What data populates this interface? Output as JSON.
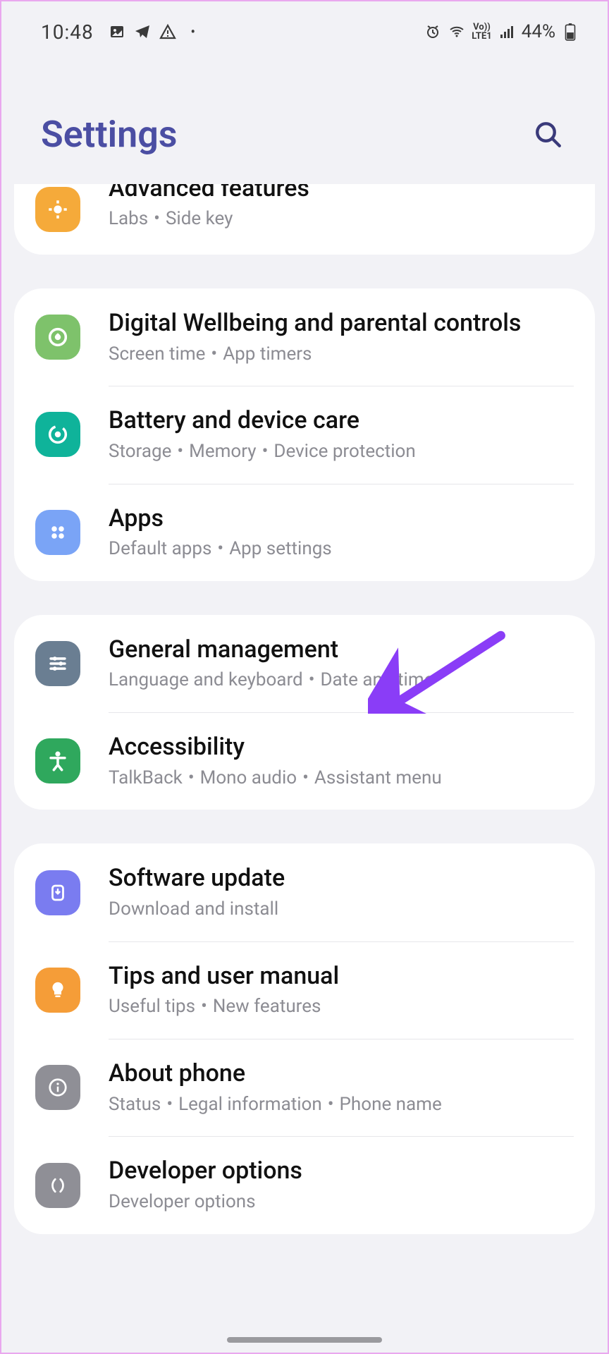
{
  "status": {
    "time": "10:48",
    "battery": "44%",
    "net_label": "LTE1",
    "vo_label": "Vo))"
  },
  "header": {
    "title": "Settings"
  },
  "groups": [
    {
      "items": [
        {
          "id": "advanced",
          "title": "Advanced features",
          "subs": [
            "Labs",
            "Side key"
          ],
          "iconColor": "#f5aa3a"
        }
      ]
    },
    {
      "items": [
        {
          "id": "wellbeing",
          "title": "Digital Wellbeing and parental controls",
          "subs": [
            "Screen time",
            "App timers"
          ],
          "iconColor": "#7ec26b"
        },
        {
          "id": "battery",
          "title": "Battery and device care",
          "subs": [
            "Storage",
            "Memory",
            "Device protection"
          ],
          "iconColor": "#0fb39a"
        },
        {
          "id": "apps",
          "title": "Apps",
          "subs": [
            "Default apps",
            "App settings"
          ],
          "iconColor": "#7aa4f6"
        }
      ]
    },
    {
      "items": [
        {
          "id": "general",
          "title": "General management",
          "subs": [
            "Language and keyboard",
            "Date and time"
          ],
          "iconColor": "#6a7e92"
        },
        {
          "id": "accessibility",
          "title": "Accessibility",
          "subs": [
            "TalkBack",
            "Mono audio",
            "Assistant menu"
          ],
          "iconColor": "#2fa85d"
        }
      ]
    },
    {
      "items": [
        {
          "id": "software",
          "title": "Software update",
          "subs": [
            "Download and install"
          ],
          "iconColor": "#7a7cf0"
        },
        {
          "id": "tips",
          "title": "Tips and user manual",
          "subs": [
            "Useful tips",
            "New features"
          ],
          "iconColor": "#f59d38"
        },
        {
          "id": "about",
          "title": "About phone",
          "subs": [
            "Status",
            "Legal information",
            "Phone name"
          ],
          "iconColor": "#8f8f96"
        },
        {
          "id": "developer",
          "title": "Developer options",
          "subs": [
            "Developer options"
          ],
          "iconColor": "#8f8f96"
        }
      ]
    }
  ],
  "annotation": {
    "target": "general",
    "color": "#8a3df7"
  }
}
